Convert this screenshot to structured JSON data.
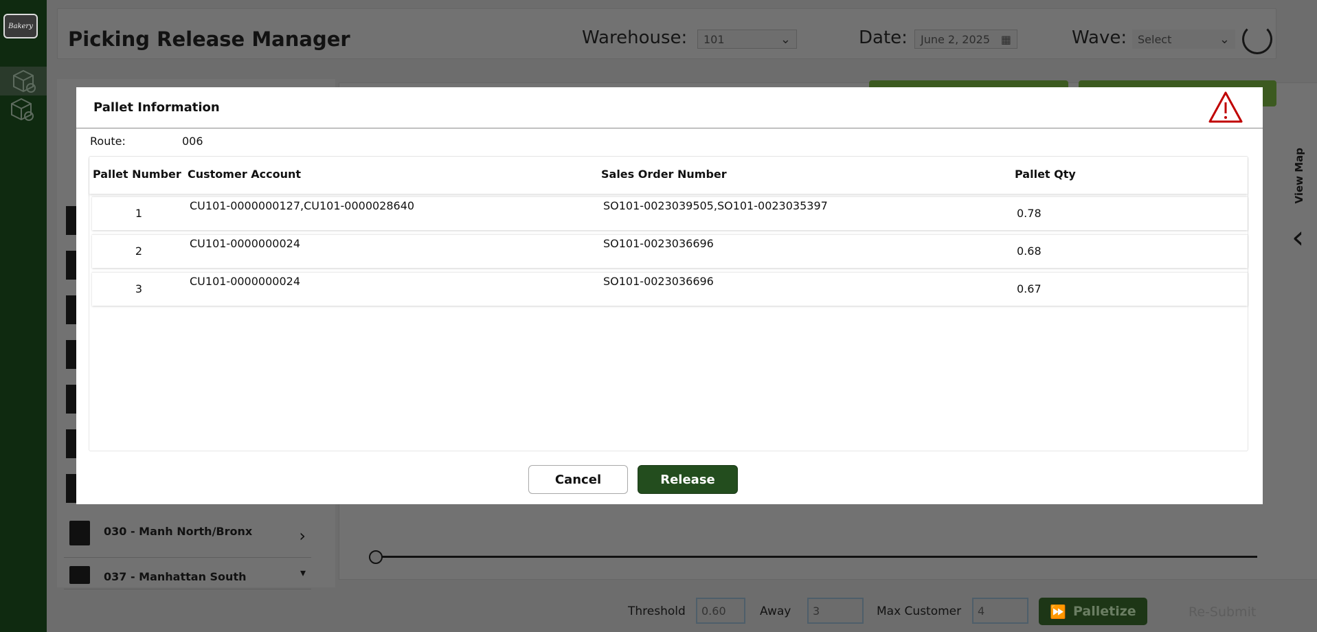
{
  "app": {
    "title": "Picking Release Manager",
    "logo_text": "Bakery",
    "warehouse_label": "Warehouse:",
    "warehouse_value": "101",
    "date_label": "Date:",
    "date_value": "June 2, 2025",
    "wave_label": "Wave:",
    "wave_placeholder": "Select",
    "view_map_label": "View Map"
  },
  "routes": [
    {
      "label": "030 - Manh North/Bronx"
    },
    {
      "label": "037 - Manhattan South"
    }
  ],
  "footer": {
    "threshold_label": "Threshold",
    "threshold_value": "0.60",
    "away_label": "Away",
    "away_value": "3",
    "max_customer_label": "Max Customer",
    "max_customer_value": "4",
    "palletize_label": "Palletize",
    "resubmit_label": "Re-Submit"
  },
  "modal": {
    "title": "Pallet Information",
    "route_label": "Route:",
    "route_value": "006",
    "columns": [
      "Pallet Number",
      "Customer Account",
      "Sales Order Number",
      "Pallet Qty"
    ],
    "rows": [
      {
        "pallet_number": "1",
        "customer_account": "CU101-0000000127,CU101-0000028640",
        "sales_order": "SO101-0023039505,SO101-0023035397",
        "pallet_qty": "0.78"
      },
      {
        "pallet_number": "2",
        "customer_account": "CU101-0000000024",
        "sales_order": "SO101-0023036696",
        "pallet_qty": "0.68"
      },
      {
        "pallet_number": "3",
        "customer_account": "CU101-0000000024",
        "sales_order": "SO101-0023036696",
        "pallet_qty": "0.67"
      }
    ],
    "cancel_label": "Cancel",
    "release_label": "Release"
  },
  "colors": {
    "release_button": "#234d1e",
    "warning_icon": "#c00000",
    "overlay": "#6d6d6d",
    "nav": "#0f2a10"
  }
}
